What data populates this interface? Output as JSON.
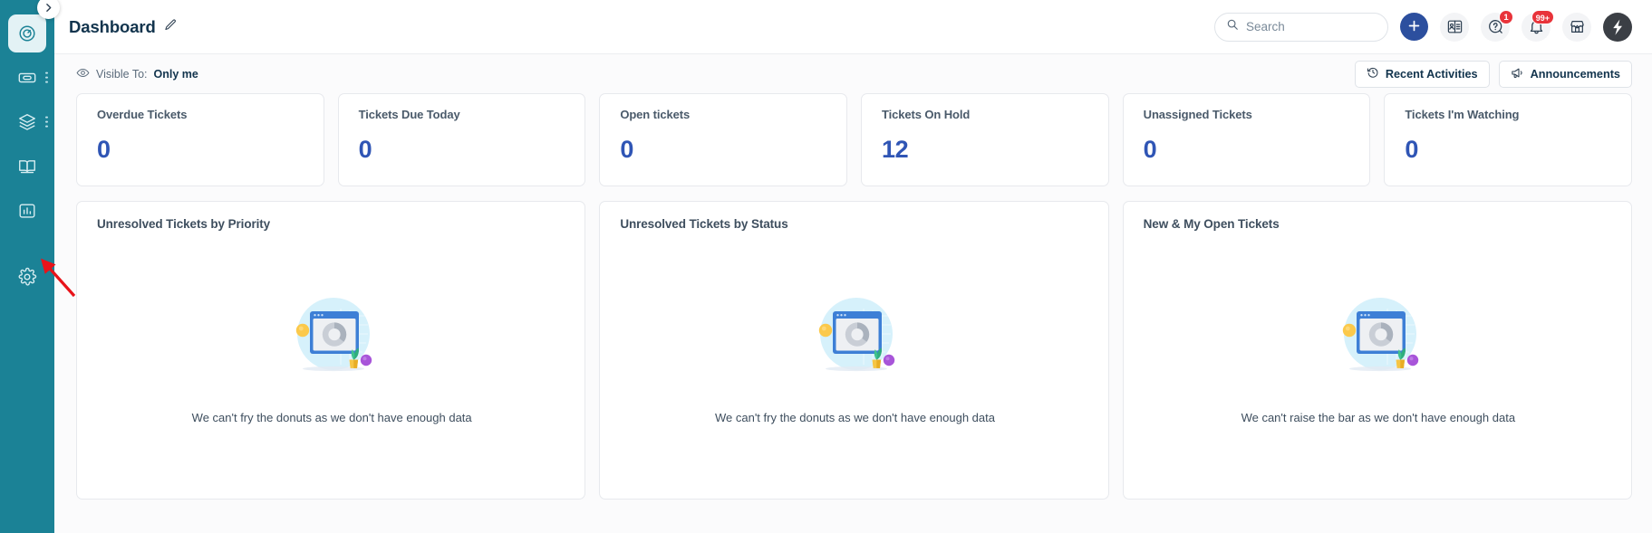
{
  "theme": {
    "sidebar_bg": "#1b8296",
    "accent_blue": "#2f55b5",
    "badge_red": "#e8333a",
    "title_color": "#12344d",
    "page_bg": "#fbfbfc"
  },
  "sidebar": {
    "collapse_icon": "chevron-right-icon",
    "items": [
      {
        "name": "dashboard",
        "icon": "gauge-icon",
        "active": true,
        "has_more": false
      },
      {
        "name": "tickets",
        "icon": "ticket-icon",
        "active": false,
        "has_more": true
      },
      {
        "name": "solutions",
        "icon": "layers-icon",
        "active": false,
        "has_more": true
      },
      {
        "name": "knowledge-base",
        "icon": "book-icon",
        "active": false,
        "has_more": false
      },
      {
        "name": "reports",
        "icon": "bar-chart-icon",
        "active": false,
        "has_more": false
      },
      {
        "name": "admin-settings",
        "icon": "gear-icon",
        "active": false,
        "has_more": false
      }
    ]
  },
  "annotation": {
    "arrow": "red-arrow-pointing-to-settings",
    "color": "#e8131a"
  },
  "header": {
    "title": "Dashboard",
    "edit_icon": "pencil-icon",
    "search": {
      "icon": "search-icon",
      "placeholder": "Search",
      "value": ""
    },
    "add_button": {
      "icon": "plus-icon",
      "label": ""
    },
    "icons": [
      {
        "name": "contacts-icon",
        "badge": null
      },
      {
        "name": "help-icon",
        "badge": "1"
      },
      {
        "name": "notifications-bell-icon",
        "badge": "99+"
      },
      {
        "name": "marketplace-icon",
        "badge": null
      },
      {
        "name": "freshworks-switcher-icon",
        "badge": null
      }
    ]
  },
  "subheader": {
    "eye_icon": "eye-icon",
    "visible_to_label": "Visible To:",
    "visible_to_value": "Only me",
    "recent_activities": {
      "label": "Recent Activities",
      "icon": "history-clock-icon"
    },
    "announcements": {
      "label": "Announcements",
      "icon": "megaphone-icon"
    }
  },
  "stats": [
    {
      "label": "Overdue Tickets",
      "value": "0"
    },
    {
      "label": "Tickets Due Today",
      "value": "0"
    },
    {
      "label": "Open tickets",
      "value": "0"
    },
    {
      "label": "Tickets On Hold",
      "value": "12"
    },
    {
      "label": "Unassigned Tickets",
      "value": "0"
    },
    {
      "label": "Tickets I'm Watching",
      "value": "0"
    }
  ],
  "panels": [
    {
      "title": "Unresolved Tickets by Priority",
      "empty_message": "We can't fry the donuts as we don't have enough data",
      "illustration": "empty-donut-chart-illustration"
    },
    {
      "title": "Unresolved Tickets by Status",
      "empty_message": "We can't fry the donuts as we don't have enough data",
      "illustration": "empty-donut-chart-illustration"
    },
    {
      "title": "New & My Open Tickets",
      "empty_message": "We can't raise the bar as we don't have enough data",
      "illustration": "empty-bar-chart-illustration"
    }
  ]
}
